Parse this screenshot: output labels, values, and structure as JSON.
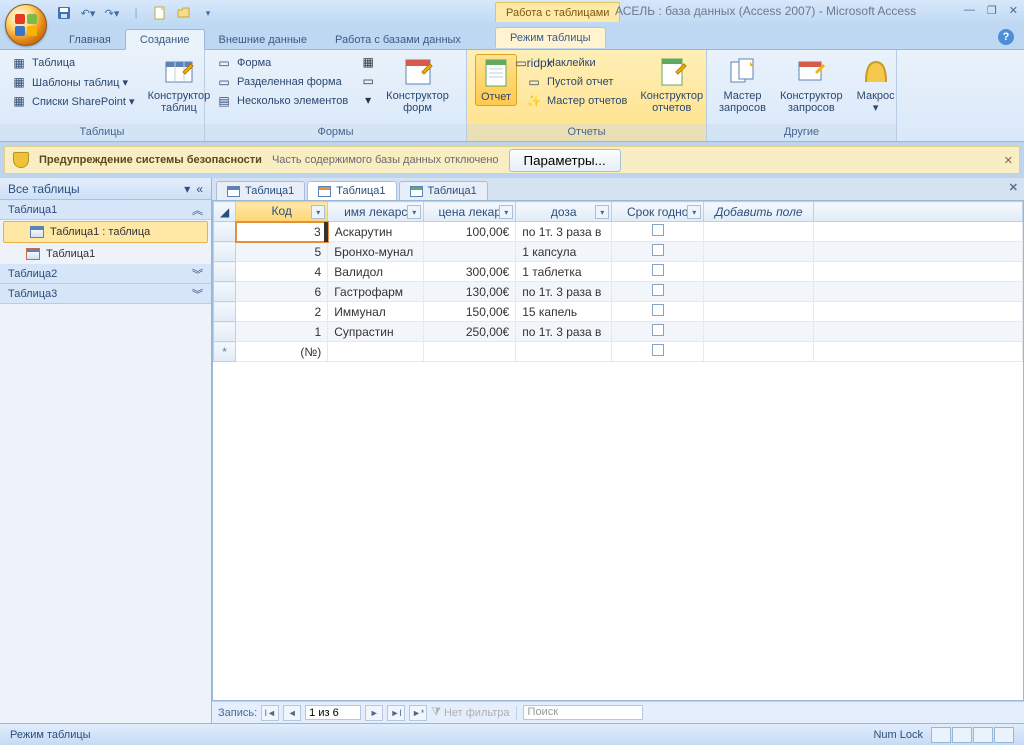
{
  "title": {
    "context_tab": "Работа с таблицами",
    "app_title": "АСЕЛЬ : база данных (Access 2007) - Microsoft Access"
  },
  "tabs": {
    "t0": "Главная",
    "t1": "Создание",
    "t2": "Внешние данные",
    "t3": "Работа с базами данных",
    "t4": "Режим таблицы"
  },
  "ribbon": {
    "tables": {
      "label": "Таблицы",
      "i0": "Таблица",
      "i1": "Шаблоны таблиц ▾",
      "i2": "Списки SharePoint ▾",
      "big": "Конструктор\nтаблиц"
    },
    "forms": {
      "label": "Формы",
      "i0": "Форма",
      "i1": "Разделенная форма",
      "i2": "Несколько элементов",
      "big": "Конструктор\nформ"
    },
    "reports": {
      "label": "Отчеты",
      "big_sel": "Отчет",
      "i0": "Наклейки",
      "i1": "Пустой отчет",
      "i2": "Мастер отчетов",
      "big2": "Конструктор\nотчетов"
    },
    "other": {
      "label": "Другие",
      "b0": "Мастер\nзапросов",
      "b1": "Конструктор\nзапросов",
      "b2": "Макрос\n▾"
    }
  },
  "security": {
    "title": "Предупреждение системы безопасности",
    "text": "Часть содержимого базы данных отключено",
    "button": "Параметры..."
  },
  "nav": {
    "header": "Все таблицы",
    "g0": "Таблица1",
    "g0_i0": "Таблица1 : таблица",
    "g0_i1": "Таблица1",
    "g1": "Таблица2",
    "g2": "Таблица3"
  },
  "doctabs": {
    "t0": "Таблица1",
    "t1": "Таблица1",
    "t2": "Таблица1"
  },
  "grid": {
    "cols": {
      "c0": "Код",
      "c1": "имя лекарс",
      "c2": "цена лекар",
      "c3": "доза",
      "c4": "Срок годно",
      "add": "Добавить поле"
    },
    "rows": [
      {
        "id": "3",
        "name": "Аскарутин",
        "price": "100,00€",
        "dose": "по 1т. 3 раза в"
      },
      {
        "id": "5",
        "name": "Бронхо-мунал",
        "price": "",
        "dose": "1 капсула"
      },
      {
        "id": "4",
        "name": "Валидол",
        "price": "300,00€",
        "dose": "1 таблетка"
      },
      {
        "id": "6",
        "name": "Гастрофарм",
        "price": "130,00€",
        "dose": "по 1т. 3 раза в"
      },
      {
        "id": "2",
        "name": "Иммунал",
        "price": "150,00€",
        "dose": "15 капель"
      },
      {
        "id": "1",
        "name": "Супрастин",
        "price": "250,00€",
        "dose": "по 1т. 3 раза в"
      }
    ],
    "new_id": "(№)"
  },
  "recnav": {
    "label": "Запись:",
    "pos": "1 из 6",
    "filter": "Нет фильтра",
    "search": "Поиск"
  },
  "status": {
    "mode": "Режим таблицы",
    "numlock": "Num Lock"
  }
}
